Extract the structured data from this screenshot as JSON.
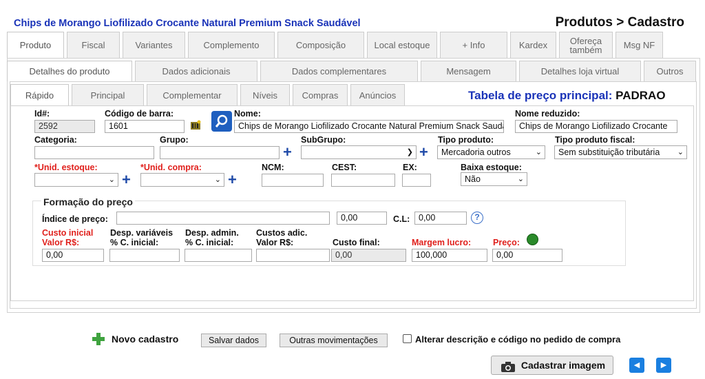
{
  "header": {
    "product_name": "Chips de Morango Liofilizado Crocante Natural Premium Snack Saudável",
    "page_title": "Produtos > Cadastro"
  },
  "tabs_main": [
    "Produto",
    "Fiscal",
    "Variantes",
    "Complemento",
    "Composição",
    "Local estoque",
    "+ Info",
    "Kardex",
    "Ofereça também",
    "Msg NF"
  ],
  "tabs_details": [
    "Detalhes do produto",
    "Dados adicionais",
    "Dados complementares",
    "Mensagem",
    "Detalhes loja virtual",
    "Outros"
  ],
  "tabs_sub": [
    "Rápido",
    "Principal",
    "Complementar",
    "Níveis",
    "Compras",
    "Anúncios"
  ],
  "price_table": {
    "label": "Tabela de preço principal:",
    "value": "PADRAO"
  },
  "fields": {
    "id_label": "Id#:",
    "id_value": "2592",
    "barcode_label": "Código de barra:",
    "barcode_value": "1601",
    "name_label": "Nome:",
    "name_value": "Chips de Morango Liofilizado Crocante Natural Premium Snack Saudável",
    "short_name_label": "Nome reduzido:",
    "short_name_value": "Chips de Morango Liofilizado Crocante",
    "category_label": "Categoria:",
    "group_label": "Grupo:",
    "subgroup_label": "SubGrupo:",
    "product_type_label": "Tipo produto:",
    "product_type_value": "Mercadoria outros",
    "fiscal_type_label": "Tipo produto fiscal:",
    "fiscal_type_value": "Sem substituição tributária",
    "unit_stock_label": "*Unid. estoque:",
    "unit_purchase_label": "*Unid. compra:",
    "ncm_label": "NCM:",
    "cest_label": "CEST:",
    "ex_label": "EX:",
    "low_stock_label": "Baixa estoque:",
    "low_stock_value": "Não"
  },
  "pricing": {
    "legend": "Formação do preço",
    "index_label": "Índice de preço:",
    "index_value": "0,00",
    "cl_label": "C.L:",
    "cl_value": "0,00",
    "cost_label_1": "Custo inicial",
    "cost_label_2": "Valor R$:",
    "cost_value": "0,00",
    "var_label_1": "Desp. variáveis",
    "var_label_2": "% C. inicial:",
    "adm_label_1": "Desp. admin.",
    "adm_label_2": "% C. inicial:",
    "add_label_1": "Custos adic.",
    "add_label_2": "Valor R$:",
    "final_label": "Custo final:",
    "final_value": "0,00",
    "margin_label": "Margem lucro:",
    "margin_value": "100,000",
    "price_label": "Preço:",
    "price_value": "0,00"
  },
  "footer": {
    "new_label": "Novo cadastro",
    "save_label": "Salvar dados",
    "other_label": "Outras movimentações",
    "checkbox_label": "Alterar descrição e código no pedido de compra",
    "image_label": "Cadastrar imagem"
  },
  "colors": {
    "accent": "#1a33b8",
    "required": "#e0201c",
    "nav": "#1a7fe0"
  }
}
